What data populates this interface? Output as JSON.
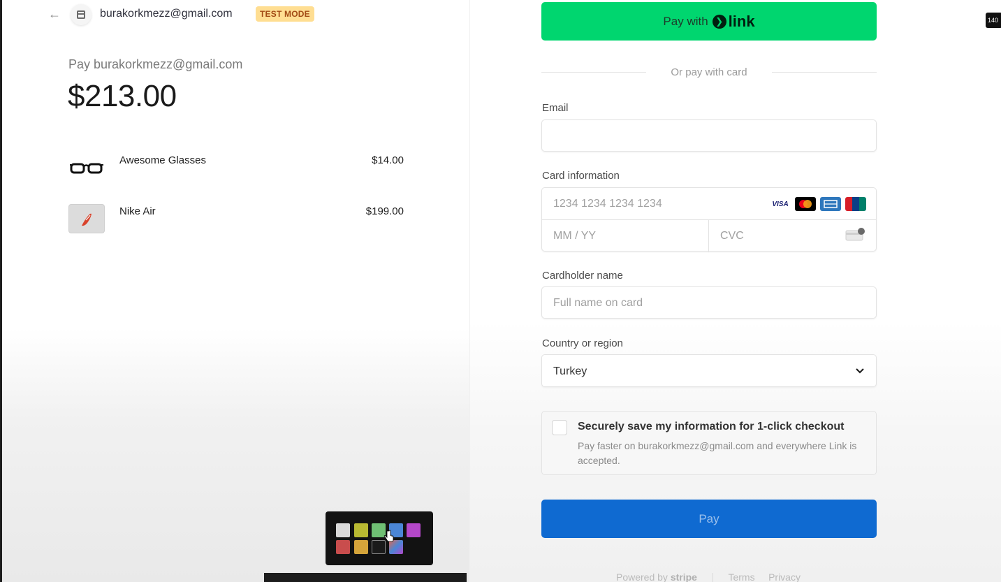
{
  "header": {
    "merchant": "burakorkmezz@gmail.com",
    "badge": "TEST MODE",
    "back_icon": "arrow-left-icon",
    "merchant_icon": "store-icon"
  },
  "summary": {
    "pay_label": "Pay burakorkmezz@gmail.com",
    "total": "$213.00",
    "items": [
      {
        "name": "Awesome Glasses",
        "price": "$14.00",
        "icon": "glasses-icon"
      },
      {
        "name": "Nike Air",
        "price": "$199.00",
        "icon": "shoe-image"
      }
    ]
  },
  "link_button": {
    "label": "Pay with",
    "brand": "link"
  },
  "divider_text": "Or pay with card",
  "form": {
    "email": {
      "label": "Email",
      "value": ""
    },
    "card": {
      "label": "Card information",
      "number_placeholder": "1234 1234 1234 1234",
      "expiry_placeholder": "MM / YY",
      "cvc_placeholder": "CVC",
      "brands": [
        "VISA",
        "mastercard",
        "amex",
        "unionpay"
      ]
    },
    "cardholder": {
      "label": "Cardholder name",
      "placeholder": "Full name on card"
    },
    "country": {
      "label": "Country or region",
      "value": "Turkey"
    },
    "save": {
      "title": "Securely save my information for 1-click checkout",
      "desc": "Pay faster on burakorkmezz@gmail.com and everywhere Link is accepted."
    },
    "pay_label": "Pay"
  },
  "footer": {
    "powered": "Powered by",
    "brand": "stripe",
    "terms": "Terms",
    "privacy": "Privacy"
  },
  "colors": {
    "link_green": "#00d66f",
    "pay_blue": "#0f6ad1",
    "badge_bg": "#ffde92",
    "palette": [
      "#d9d9d9",
      "#b9b932",
      "#6fbf73",
      "#4b86d6",
      "#b447c9",
      "#c94d4d",
      "#d4a43a",
      "#1a1a1a",
      "#e0664f"
    ]
  },
  "corner_badge": "140"
}
